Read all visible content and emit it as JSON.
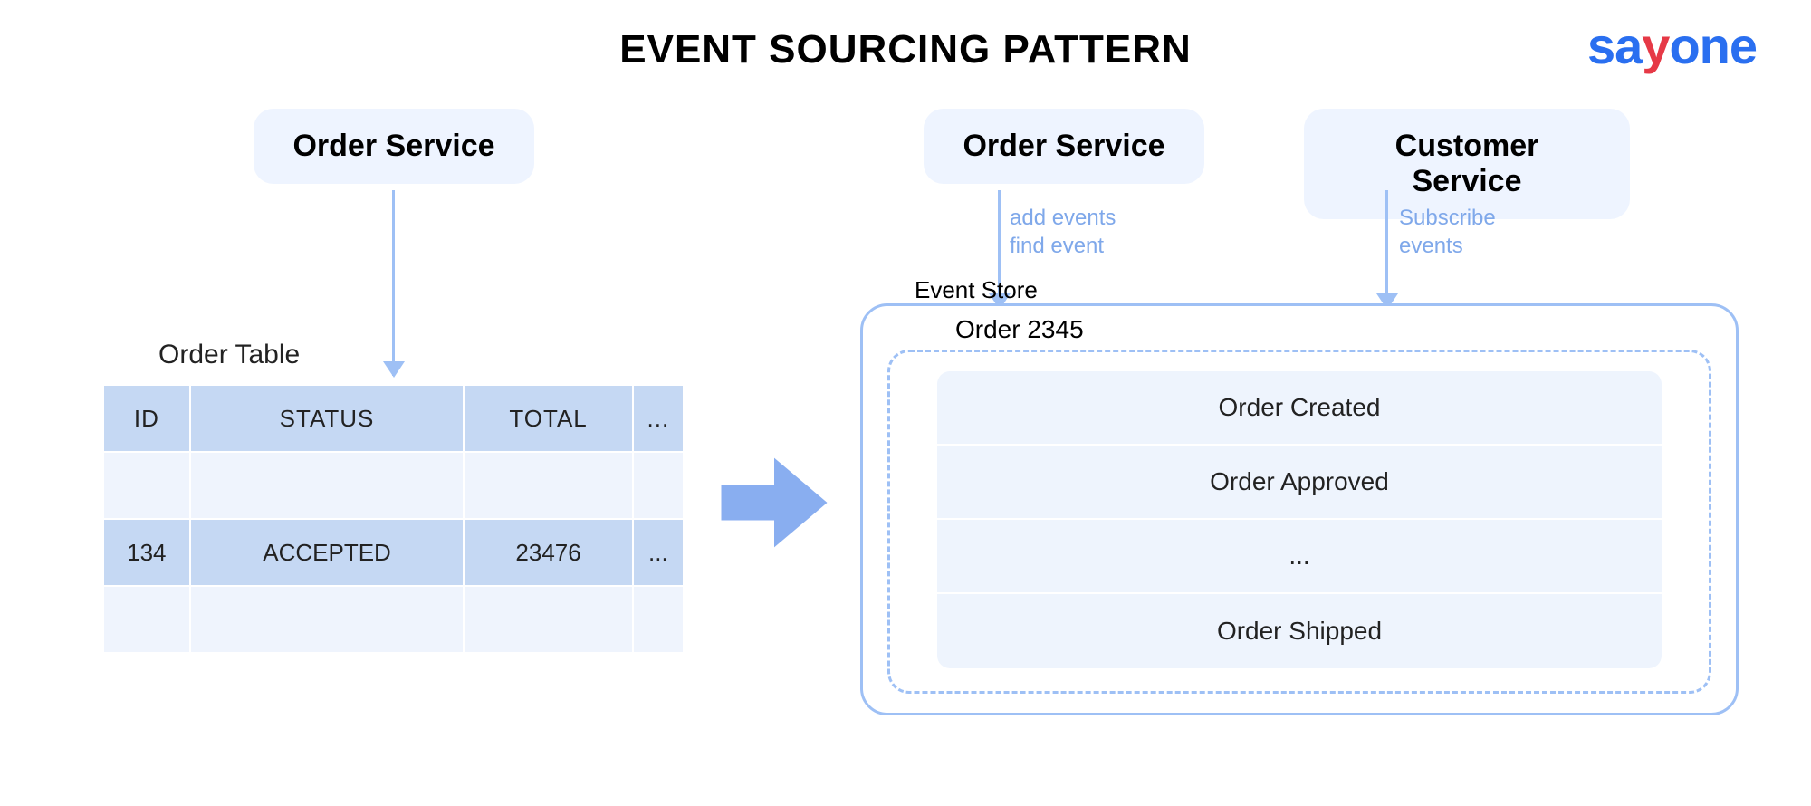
{
  "title": "EVENT SOURCING PATTERN",
  "logo": {
    "prefix": "sa",
    "accent": "y",
    "suffix": "one"
  },
  "services": {
    "left": "Order Service",
    "right1": "Order Service",
    "right2": "Customer Service"
  },
  "arrow_labels": {
    "add_find": "add events\nfind event",
    "subscribe": "Subscribe\nevents"
  },
  "order_table": {
    "label": "Order Table",
    "headers": [
      "ID",
      "STATUS",
      "TOTAL",
      "..."
    ],
    "rows": [
      [
        "",
        "",
        "",
        ""
      ],
      [
        "134",
        "ACCEPTED",
        "23476",
        "..."
      ],
      [
        "",
        "",
        "",
        ""
      ]
    ]
  },
  "event_store": {
    "label": "Event Store",
    "order_label": "Order 2345",
    "events": [
      "Order Created",
      "Order Approved",
      "...",
      "Order Shipped"
    ]
  }
}
